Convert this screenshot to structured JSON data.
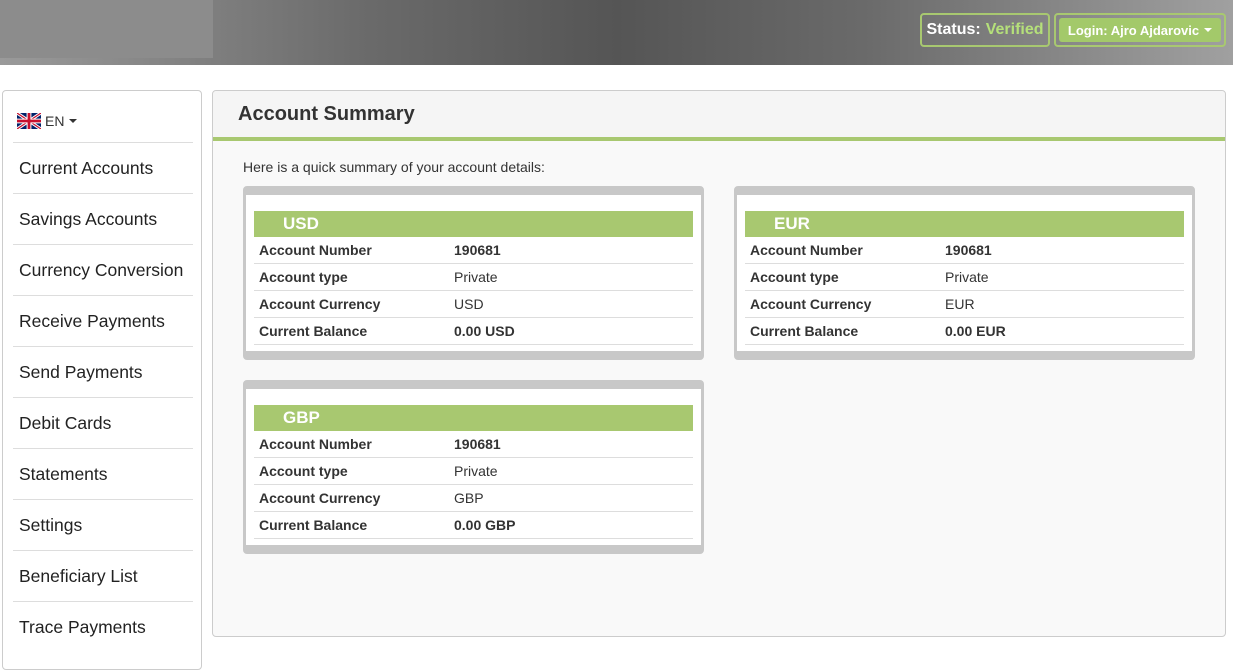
{
  "header": {
    "status_label": "Status:",
    "status_value": "Verified",
    "login_label": "Login: Ajro Ajdarovic"
  },
  "sidebar": {
    "language": "EN",
    "items": [
      {
        "label": "Current Accounts"
      },
      {
        "label": "Savings Accounts"
      },
      {
        "label": "Currency Conversion"
      },
      {
        "label": "Receive Payments"
      },
      {
        "label": "Send Payments"
      },
      {
        "label": "Debit Cards"
      },
      {
        "label": "Statements"
      },
      {
        "label": "Settings"
      },
      {
        "label": "Beneficiary List"
      },
      {
        "label": "Trace Payments"
      }
    ]
  },
  "main": {
    "title": "Account Summary",
    "intro": "Here is a quick summary of your account details:",
    "accounts": [
      {
        "currency": "USD",
        "rows": [
          {
            "label": "Account Number",
            "value": "190681"
          },
          {
            "label": "Account type",
            "value": "Private"
          },
          {
            "label": "Account Currency",
            "value": "USD"
          },
          {
            "label": "Current Balance",
            "value": "0.00 USD"
          }
        ]
      },
      {
        "currency": "EUR",
        "rows": [
          {
            "label": "Account Number",
            "value": "190681"
          },
          {
            "label": "Account type",
            "value": "Private"
          },
          {
            "label": "Account Currency",
            "value": "EUR"
          },
          {
            "label": "Current Balance",
            "value": "0.00 EUR"
          }
        ]
      },
      {
        "currency": "GBP",
        "rows": [
          {
            "label": "Account Number",
            "value": "190681"
          },
          {
            "label": "Account type",
            "value": "Private"
          },
          {
            "label": "Account Currency",
            "value": "GBP"
          },
          {
            "label": "Current Balance",
            "value": "0.00 GBP"
          }
        ]
      }
    ]
  },
  "colors": {
    "accent_green": "#a8c870",
    "verified_green": "#b5e07a"
  }
}
